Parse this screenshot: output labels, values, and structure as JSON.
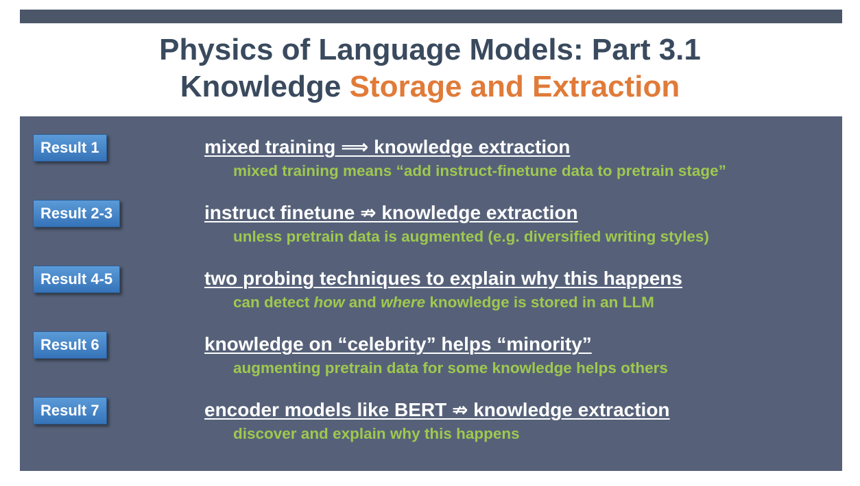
{
  "title": {
    "line1": "Physics of Language Models: Part 3.1",
    "line2_prefix": "Knowledge ",
    "line2_accent": "Storage and Extraction"
  },
  "results": [
    {
      "label": "Result 1",
      "main": "mixed training ⟹ knowledge extraction",
      "sub": "mixed training means “add instruct-finetune data to pretrain stage”"
    },
    {
      "label": "Result 2-3",
      "main": "instruct finetune ⇏ knowledge extraction",
      "sub": "unless pretrain data is augmented (e.g. diversified writing styles)"
    },
    {
      "label": "Result 4-5",
      "main": "two probing techniques to explain why this happens",
      "sub_part1": "can detect ",
      "sub_em1": "how",
      "sub_part2": " and ",
      "sub_em2": "where",
      "sub_part3": " knowledge is stored in an LLM"
    },
    {
      "label": "Result 6",
      "main": "knowledge on “celebrity” helps “minority”",
      "sub": "augmenting pretrain data for some knowledge helps others"
    },
    {
      "label": "Result 7",
      "main": "encoder models like BERT ⇏ knowledge extraction",
      "sub": "discover and explain why this happens"
    }
  ],
  "colors": {
    "title": "#3a4a5e",
    "accent": "#e07b39",
    "panel": "#566179",
    "sub_text": "#9fc84f",
    "button": "#4a88cc"
  }
}
